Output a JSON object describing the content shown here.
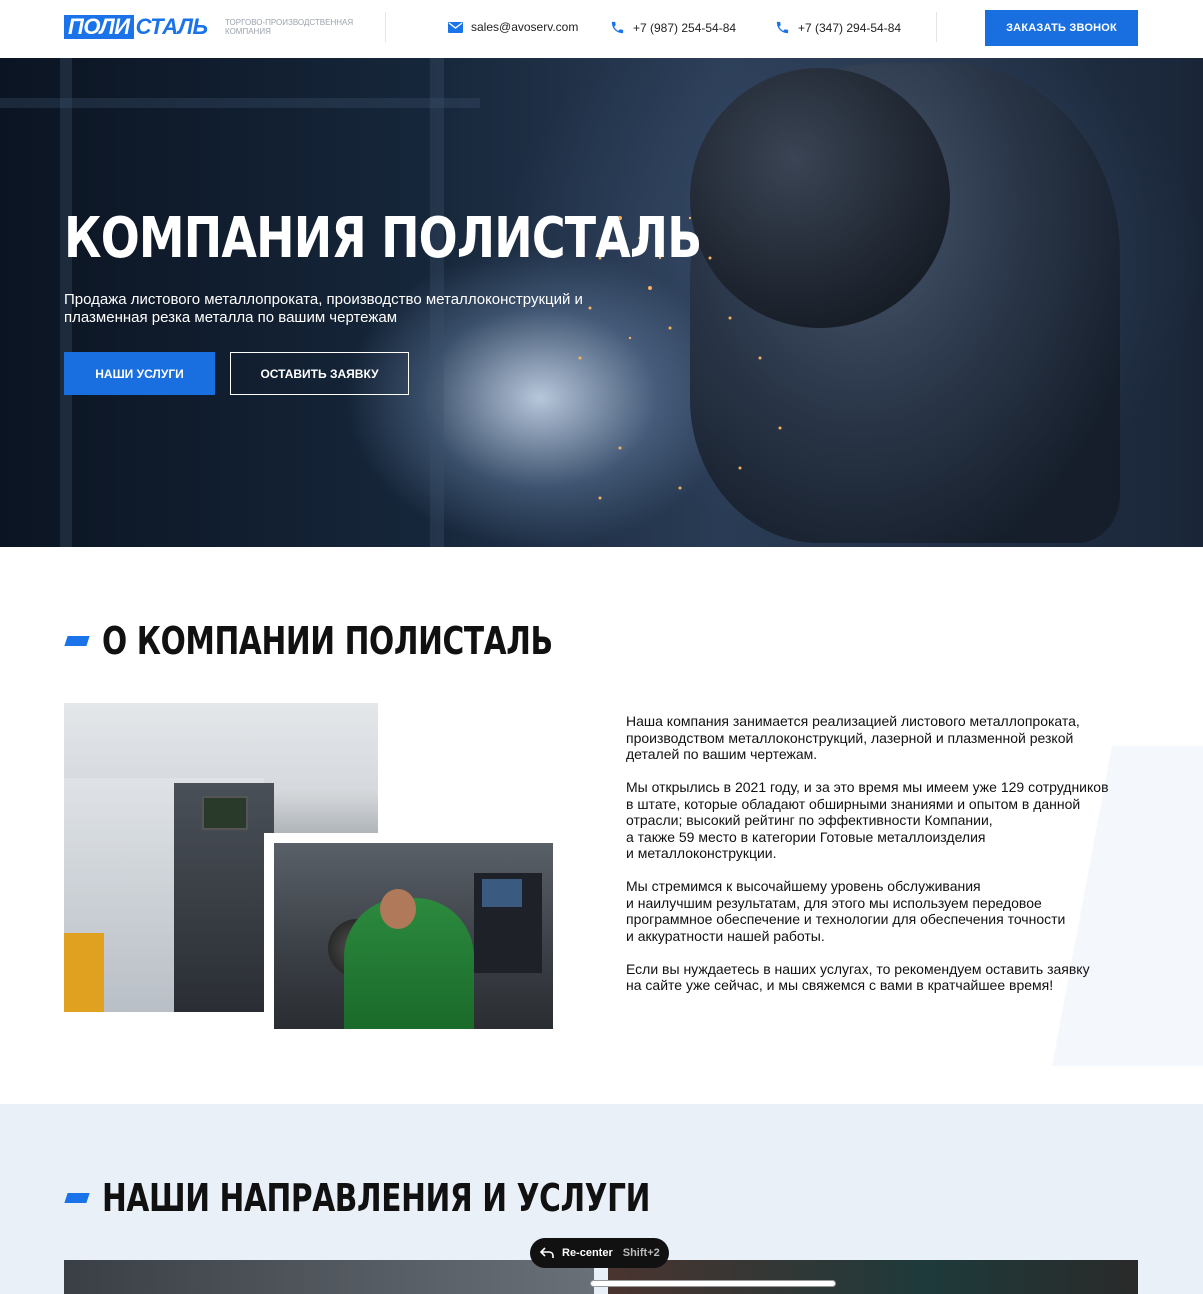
{
  "header": {
    "logo_box": "ПОЛИ",
    "logo_rest": "СТАЛЬ",
    "logo_subtitle": "Торгово-производственная компания",
    "email": "sales@avoserv.com",
    "phone1": "+7 (987) 254-54-84",
    "phone2": "+7 (347) 294-54-84",
    "callback_label": "Заказать звонок"
  },
  "hero": {
    "title": "КОМПАНИЯ ПОЛИСТАЛЬ",
    "subtitle": "Продажа листового металлопроката, производство металлоконструкций и плазменная резка металла по вашим чертежам",
    "services_button": "Наши услуги",
    "request_button": "Оставить заявку"
  },
  "about": {
    "title": "О КОМПАНИИ ПОЛИСТАЛЬ",
    "paragraphs": [
      "Наша компания занимается реализацией листового металлопроката,\nпроизводством металлоконструкций, лазерной и плазменной резкой\nдеталей по вашим чертежам.",
      "Мы открылись в 2021 году, и за это время мы имеем уже 129 сотрудников\nв штате, которые обладают обширными знаниями и опытом в данной\nотрасли; высокий рейтинг по эффективности Компании,\nа также 59 место в категории Готовые металлоизделия\nи металлоконструкции.",
      "Мы стремимся к высочайшему уровень обслуживания\nи наилучшим результатам, для этого мы используем передовое\nпрограммное обеспечение и технологии для обеспечения точности\nи аккуратности нашей работы.",
      "Если вы нуждаетесь в наших услугах, то рекомендуем оставить заявку\nна сайте уже сейчас, и мы свяжемся с вами в кратчайшее время!"
    ]
  },
  "services": {
    "title": "НАШИ НАПРАВЛЕНИЯ И УСЛУГИ"
  },
  "overlay": {
    "recenter_label": "Re-center",
    "recenter_shortcut": "Shift+2"
  },
  "colors": {
    "accent": "#1a73e8",
    "services_bg": "#eaf0f8"
  }
}
